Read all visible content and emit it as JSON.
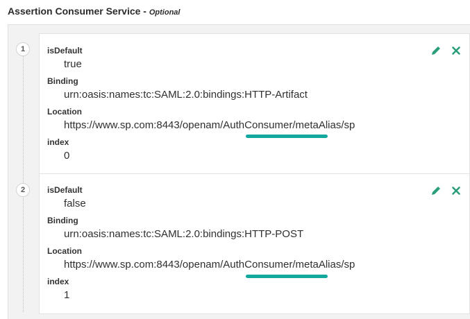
{
  "section": {
    "title": "Assertion Consumer Service",
    "separator": " - ",
    "optional_label": "Optional"
  },
  "colors": {
    "highlight": "#13a89e",
    "action_icon": "#2a9d7a"
  },
  "entries": [
    {
      "number": "1",
      "fields": [
        {
          "label": "isDefault",
          "value": "true"
        },
        {
          "label": "Binding",
          "value": "urn:oasis:names:tc:SAML:2.0:bindings:HTTP-Artifact"
        },
        {
          "label": "Location",
          "value": "https://www.sp.com:8443/openam/AuthConsumer/metaAlias/sp"
        },
        {
          "label": "index",
          "value": "0"
        }
      ],
      "edit_icon": "pencil-icon",
      "delete_icon": "close-icon"
    },
    {
      "number": "2",
      "fields": [
        {
          "label": "isDefault",
          "value": "false"
        },
        {
          "label": "Binding",
          "value": "urn:oasis:names:tc:SAML:2.0:bindings:HTTP-POST"
        },
        {
          "label": "Location",
          "value": "https://www.sp.com:8443/openam/AuthConsumer/metaAlias/sp"
        },
        {
          "label": "index",
          "value": "1"
        }
      ],
      "edit_icon": "pencil-icon",
      "delete_icon": "close-icon"
    }
  ]
}
